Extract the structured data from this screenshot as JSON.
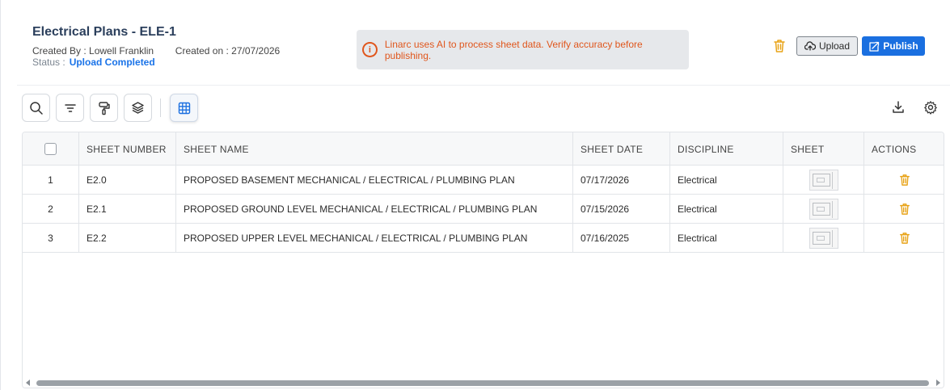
{
  "header": {
    "title": "Electrical Plans - ELE-1",
    "created_by_label": "Created By :",
    "created_by": "Lowell Franklin",
    "created_on_label": "Created on :",
    "created_on": "27/07/2026",
    "status_label": "Status :",
    "status": "Upload Completed"
  },
  "banner": {
    "icon": "info-icon",
    "message": "Linarc uses AI to process sheet data. Verify accuracy before publishing."
  },
  "actions": {
    "delete_icon": "trash-icon",
    "upload_label": "Upload",
    "publish_label": "Publish"
  },
  "toolbar": {
    "tools": [
      "search-icon",
      "filter-icon",
      "paint-roller-icon",
      "layers-icon",
      "grid-icon"
    ],
    "right": [
      "download-icon",
      "gear-icon"
    ]
  },
  "table": {
    "columns": [
      "SHEET NUMBER",
      "SHEET NAME",
      "SHEET DATE",
      "DISCIPLINE",
      "SHEET",
      "ACTIONS"
    ],
    "rows": [
      {
        "index": "1",
        "number": "E2.0",
        "name": "PROPOSED BASEMENT MECHANICAL / ELECTRICAL / PLUMBING PLAN",
        "date": "07/17/2026",
        "discipline": "Electrical"
      },
      {
        "index": "2",
        "number": "E2.1",
        "name": "PROPOSED GROUND LEVEL MECHANICAL / ELECTRICAL / PLUMBING PLAN",
        "date": "07/15/2026",
        "discipline": "Electrical"
      },
      {
        "index": "3",
        "number": "E2.2",
        "name": "PROPOSED UPPER LEVEL MECHANICAL / ELECTRICAL / PLUMBING PLAN",
        "date": "07/16/2025",
        "discipline": "Electrical"
      }
    ]
  },
  "colors": {
    "accent": "#1a6fe0",
    "warning": "#e0561c",
    "delete": "#e8a317"
  }
}
